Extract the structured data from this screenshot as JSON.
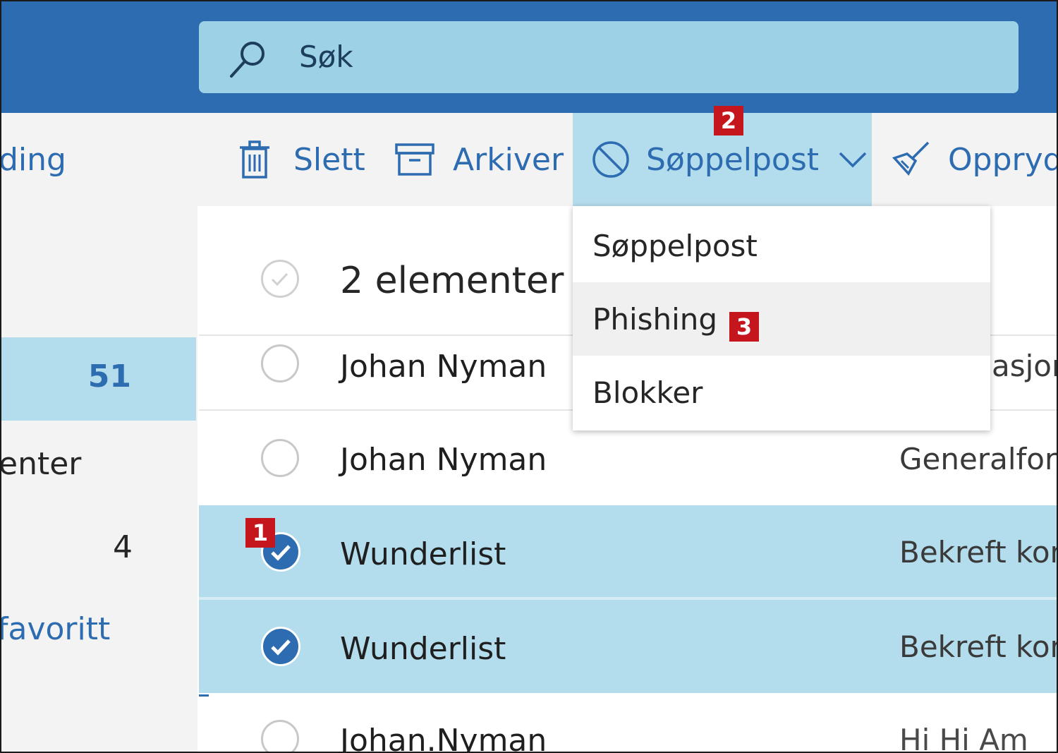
{
  "search": {
    "placeholder": "Søk"
  },
  "toolbar": {
    "partial_left_label": "ding",
    "delete_label": "Slett",
    "archive_label": "Arkiver",
    "junk_label": "Søppelpost",
    "sweep_label": "Opprydd"
  },
  "badges": {
    "step1": "1",
    "step2": "2",
    "step3": "3"
  },
  "nav": {
    "selected_count": "51",
    "item2_partial_label": "enter",
    "item3_count": "4",
    "favorites_partial_label": "favoritt"
  },
  "list": {
    "header_text": "2 elementer e",
    "rows": [
      {
        "sender": "Johan Nyman",
        "subject": "asjon",
        "selected": false
      },
      {
        "sender": "Johan Nyman",
        "subject": "Generalfors",
        "selected": false
      },
      {
        "sender": "Wunderlist",
        "subject": "Bekreft kon",
        "selected": true
      },
      {
        "sender": "Wunderlist",
        "subject": "Bekreft kon",
        "selected": true
      },
      {
        "sender": "Johan.Nyman",
        "subject": "Hi   Hi Am",
        "selected": false
      }
    ]
  },
  "junk_menu": {
    "items": [
      "Søppelpost",
      "Phishing",
      "Blokker"
    ],
    "highlighted": "Phishing"
  },
  "colors": {
    "topbar": "#2d6cb0",
    "search_bg": "#9dd2e6",
    "selection": "#b3dcec",
    "accent": "#2d6cb0",
    "badge": "#c4161c"
  }
}
